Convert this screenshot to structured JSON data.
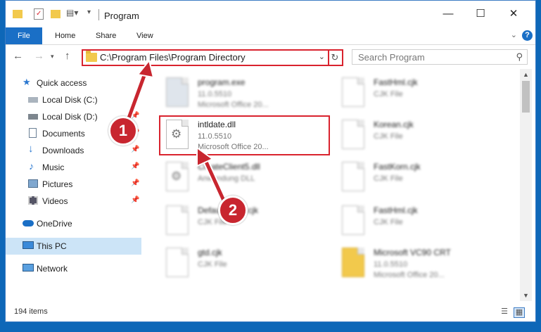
{
  "window": {
    "title": "Program",
    "minimize": "—",
    "maximize": "☐",
    "close": "✕"
  },
  "ribbon": {
    "file": "File",
    "home": "Home",
    "share": "Share",
    "view": "View",
    "help": "?"
  },
  "address": {
    "path": "C:\\Program Files\\Program Directory",
    "search_placeholder": "Search Program"
  },
  "nav_pane": {
    "quick_access": "Quick access",
    "items": [
      {
        "label": "Local Disk (C:)",
        "icon": "drive-icon",
        "pinned": false
      },
      {
        "label": "Local Disk (D:)",
        "icon": "drive-icon",
        "pinned": true
      },
      {
        "label": "Documents",
        "icon": "documents-icon",
        "pinned": true
      },
      {
        "label": "Downloads",
        "icon": "downloads-icon",
        "pinned": true
      },
      {
        "label": "Music",
        "icon": "music-icon",
        "pinned": true
      },
      {
        "label": "Pictures",
        "icon": "pictures-icon",
        "pinned": true
      },
      {
        "label": "Videos",
        "icon": "videos-icon",
        "pinned": true
      }
    ],
    "onedrive": "OneDrive",
    "this_pc": "This PC",
    "network": "Network"
  },
  "files": {
    "left": [
      {
        "name": "program.exe",
        "line2": "11.0.5510",
        "line3": "Microsoft Office 20..."
      },
      {
        "name": "intldate.dll",
        "line2": "11.0.5510",
        "line3": "Microsoft Office 20..."
      },
      {
        "name": "CreateClient5.dll",
        "line2": "Anwendung DLL",
        "line3": ""
      },
      {
        "name": "DefaultFonts.cjk",
        "line2": "CJK File",
        "line3": ""
      },
      {
        "name": "gtd.cjk",
        "line2": "CJK File",
        "line3": ""
      }
    ],
    "right": [
      {
        "name": "FastHml.cjk",
        "line2": "CJK File",
        "line3": ""
      },
      {
        "name": "Korean.cjk",
        "line2": "CJK File",
        "line3": ""
      },
      {
        "name": "FastKorn.cjk",
        "line2": "CJK File",
        "line3": ""
      },
      {
        "name": "FastHml.cjk",
        "line2": "CJK File",
        "line3": ""
      },
      {
        "name": "Microsoft VC90 CRT",
        "line2": "11.0.5510",
        "line3": "Microsoft Office 20..."
      }
    ]
  },
  "status": {
    "count": "194 items"
  },
  "annotations": {
    "step1": "1",
    "step2": "2",
    "highlight_color": "#d9232e"
  }
}
